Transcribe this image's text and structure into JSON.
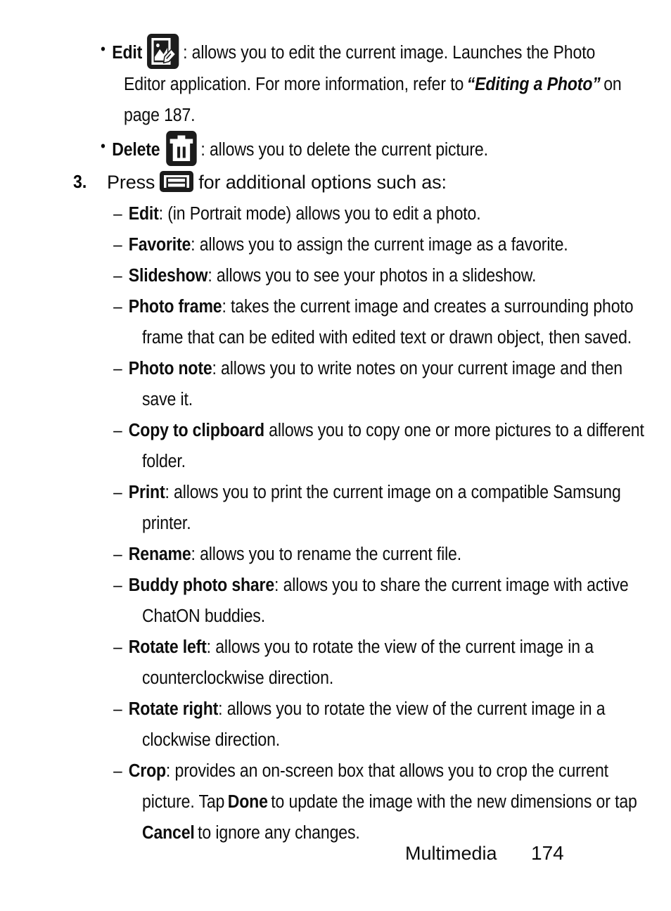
{
  "page": {
    "section": "Multimedia",
    "number": "174"
  },
  "bullets": [
    {
      "term": "Edit",
      "icon": "edit-photo-icon",
      "line1_rest": ": allows you to edit the current image. Launches the Photo",
      "line2_pre": "Editor application. For more information, refer to",
      "line2_italic": "“Editing a Photo”",
      "line2_post": "on",
      "line3": "page 187."
    },
    {
      "term": "Delete",
      "icon": "trash-icon",
      "line1_rest": ": allows you to delete the current picture."
    }
  ],
  "step": {
    "number": "3.",
    "pre": "Press",
    "icon": "menu-key-icon",
    "post": "for additional options such as:"
  },
  "options": [
    {
      "term": "Edit",
      "sep": ": ",
      "lines": [
        "(in Portrait mode) allows you to edit a photo."
      ]
    },
    {
      "term": "Favorite",
      "sep": ": ",
      "lines": [
        "allows you to assign the current image as a favorite."
      ]
    },
    {
      "term": "Slideshow",
      "sep": ": ",
      "lines": [
        "allows you to see your photos in a slideshow."
      ]
    },
    {
      "term": "Photo frame",
      "sep": ": ",
      "lines": [
        "takes the current image and creates a surrounding photo",
        "frame that can be edited with edited text or drawn object, then saved."
      ]
    },
    {
      "term": "Photo note",
      "sep": ": ",
      "lines": [
        "allows you to write notes on your current image and then",
        "save it."
      ]
    },
    {
      "term": "Copy to clipboard",
      "sep": " ",
      "lines": [
        "allows you to copy one or more pictures to a different",
        "folder."
      ]
    },
    {
      "term": "Print",
      "sep": ": ",
      "lines": [
        "allows you to print the current image on a compatible Samsung",
        "printer."
      ]
    },
    {
      "term": "Rename",
      "sep": ": ",
      "lines": [
        "allows you to rename the current file."
      ]
    },
    {
      "term": "Buddy photo share",
      "sep": ": ",
      "lines": [
        "allows you to share the current image with active",
        "ChatON buddies."
      ]
    },
    {
      "term": "Rotate left",
      "sep": ": ",
      "lines": [
        "allows you to rotate the view of the current image in a",
        "counterclockwise direction."
      ]
    },
    {
      "term": "Rotate right",
      "sep": ": ",
      "lines": [
        "allows you to rotate the view of the current image in a",
        "clockwise direction."
      ]
    }
  ],
  "crop": {
    "term": "Crop",
    "sep": ": ",
    "line1": "provides an on-screen box that allows you to crop the current",
    "line2_pre": "picture. Tap",
    "line2_bold": "Done",
    "line2_post": "to update the image with the new dimensions or tap",
    "line3_bold": "Cancel",
    "line3_post": "to ignore any changes."
  },
  "markers": {
    "bullet": "•",
    "dash": "–"
  },
  "colors": {
    "text": "#0d0d0d",
    "icon_bg": "#1c1c1c",
    "icon_fg": "#ffffff",
    "page_bg": "#ffffff"
  }
}
